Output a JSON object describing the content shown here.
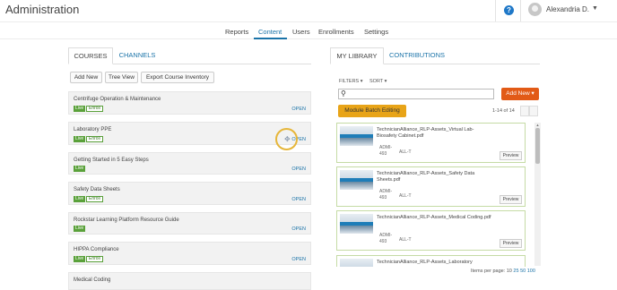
{
  "app": {
    "title": "Administration"
  },
  "user": {
    "name": "Alexandria D."
  },
  "nav": {
    "items": [
      "Reports",
      "Content",
      "Users",
      "Enrollments",
      "Settings"
    ],
    "active": "Content"
  },
  "left_tabs": [
    "COURSES",
    "CHANNELS"
  ],
  "left_actions": [
    "Add New",
    "Tree View",
    "Export Course Inventory"
  ],
  "courses": [
    {
      "title": "Centrifuge Operation & Maintenance",
      "badges": [
        "Live",
        "Enroll"
      ],
      "open": "OPEN"
    },
    {
      "title": "Laboratory PPE",
      "badges": [
        "Live",
        "Enroll"
      ],
      "open": "OPEN"
    },
    {
      "title": "Getting Started in 5 Easy Steps",
      "badges": [
        "Live"
      ],
      "open": "OPEN"
    },
    {
      "title": "Safety Data Sheets",
      "badges": [
        "Live",
        "Enroll"
      ],
      "open": "OPEN"
    },
    {
      "title": "Rockstar Learning Platform Resource Guide",
      "badges": [
        "Live"
      ],
      "open": "OPEN"
    },
    {
      "title": "HIPPA Compliance",
      "badges": [
        "Live",
        "Enroll"
      ],
      "open": "OPEN"
    },
    {
      "title": "Medical Coding",
      "badges": [],
      "open": ""
    }
  ],
  "right_tabs": [
    "MY LIBRARY",
    "CONTRIBUTIONS"
  ],
  "library": {
    "filters": "FILTERS ▾",
    "sort": "SORT ▾",
    "search_placeholder": "",
    "add_new": "Add New ▾",
    "batch": "Module Batch Editing",
    "range": "1-14 of 14",
    "cards": [
      {
        "title": "TechnicianAlliance_RLP-Assets_Virtual Lab-Biosafety Cabinet.pdf",
        "meta1": "ADMI-",
        "meta2": "493",
        "tag": "ALL-T",
        "preview": "Preview"
      },
      {
        "title": "TechnicianAlliance_RLP-Assets_Safety Data Sheets.pdf",
        "meta1": "ADMI-",
        "meta2": "493",
        "tag": "ALL-T",
        "preview": "Preview"
      },
      {
        "title": "TechnicianAlliance_RLP-Assets_Medical Coding.pdf",
        "meta1": "ADMI-",
        "meta2": "493",
        "tag": "ALL-T",
        "preview": "Preview"
      },
      {
        "title": "TechnicianAlliance_RLP-Assets_Laboratory",
        "meta1": "",
        "meta2": "",
        "tag": "",
        "preview": ""
      }
    ],
    "items_per_page_label": "Items per page:",
    "items_per_page": [
      "10",
      "25",
      "50",
      "100"
    ],
    "items_per_page_current": "10"
  },
  "colors": {
    "accent": "#1a73a8",
    "live": "#5aa13a",
    "add_new": "#e25a16",
    "batch": "#e8a418"
  }
}
